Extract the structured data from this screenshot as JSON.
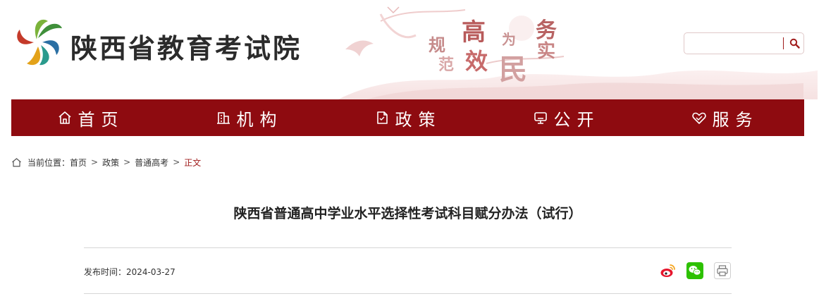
{
  "header": {
    "site_title": "陕西省教育考试院",
    "slogan_chars": [
      "高",
      "规",
      "范",
      "效",
      "为",
      "民",
      "务",
      "实"
    ],
    "search": {
      "placeholder": "",
      "value": ""
    }
  },
  "nav": {
    "items": [
      {
        "label": "首页",
        "icon": "home-icon"
      },
      {
        "label": "机构",
        "icon": "building-icon"
      },
      {
        "label": "政策",
        "icon": "document-icon"
      },
      {
        "label": "公开",
        "icon": "monitor-icon"
      },
      {
        "label": "服务",
        "icon": "heart-handshake-icon"
      }
    ]
  },
  "breadcrumb": {
    "prefix": "当前位置：",
    "items": [
      "首页",
      "政策",
      "普通高考"
    ],
    "current": "正文",
    "separator": ">"
  },
  "article": {
    "title": "陕西省普通高中学业水平选择性考试科目赋分办法（试行）",
    "publish_label": "发布时间：",
    "publish_date": "2024-03-27"
  },
  "share": {
    "icons": [
      "weibo-icon",
      "wechat-icon",
      "print-icon"
    ]
  },
  "colors": {
    "nav_bg": "#8e0b10",
    "accent": "#a01c1c",
    "rule": "#d6d6d6"
  }
}
